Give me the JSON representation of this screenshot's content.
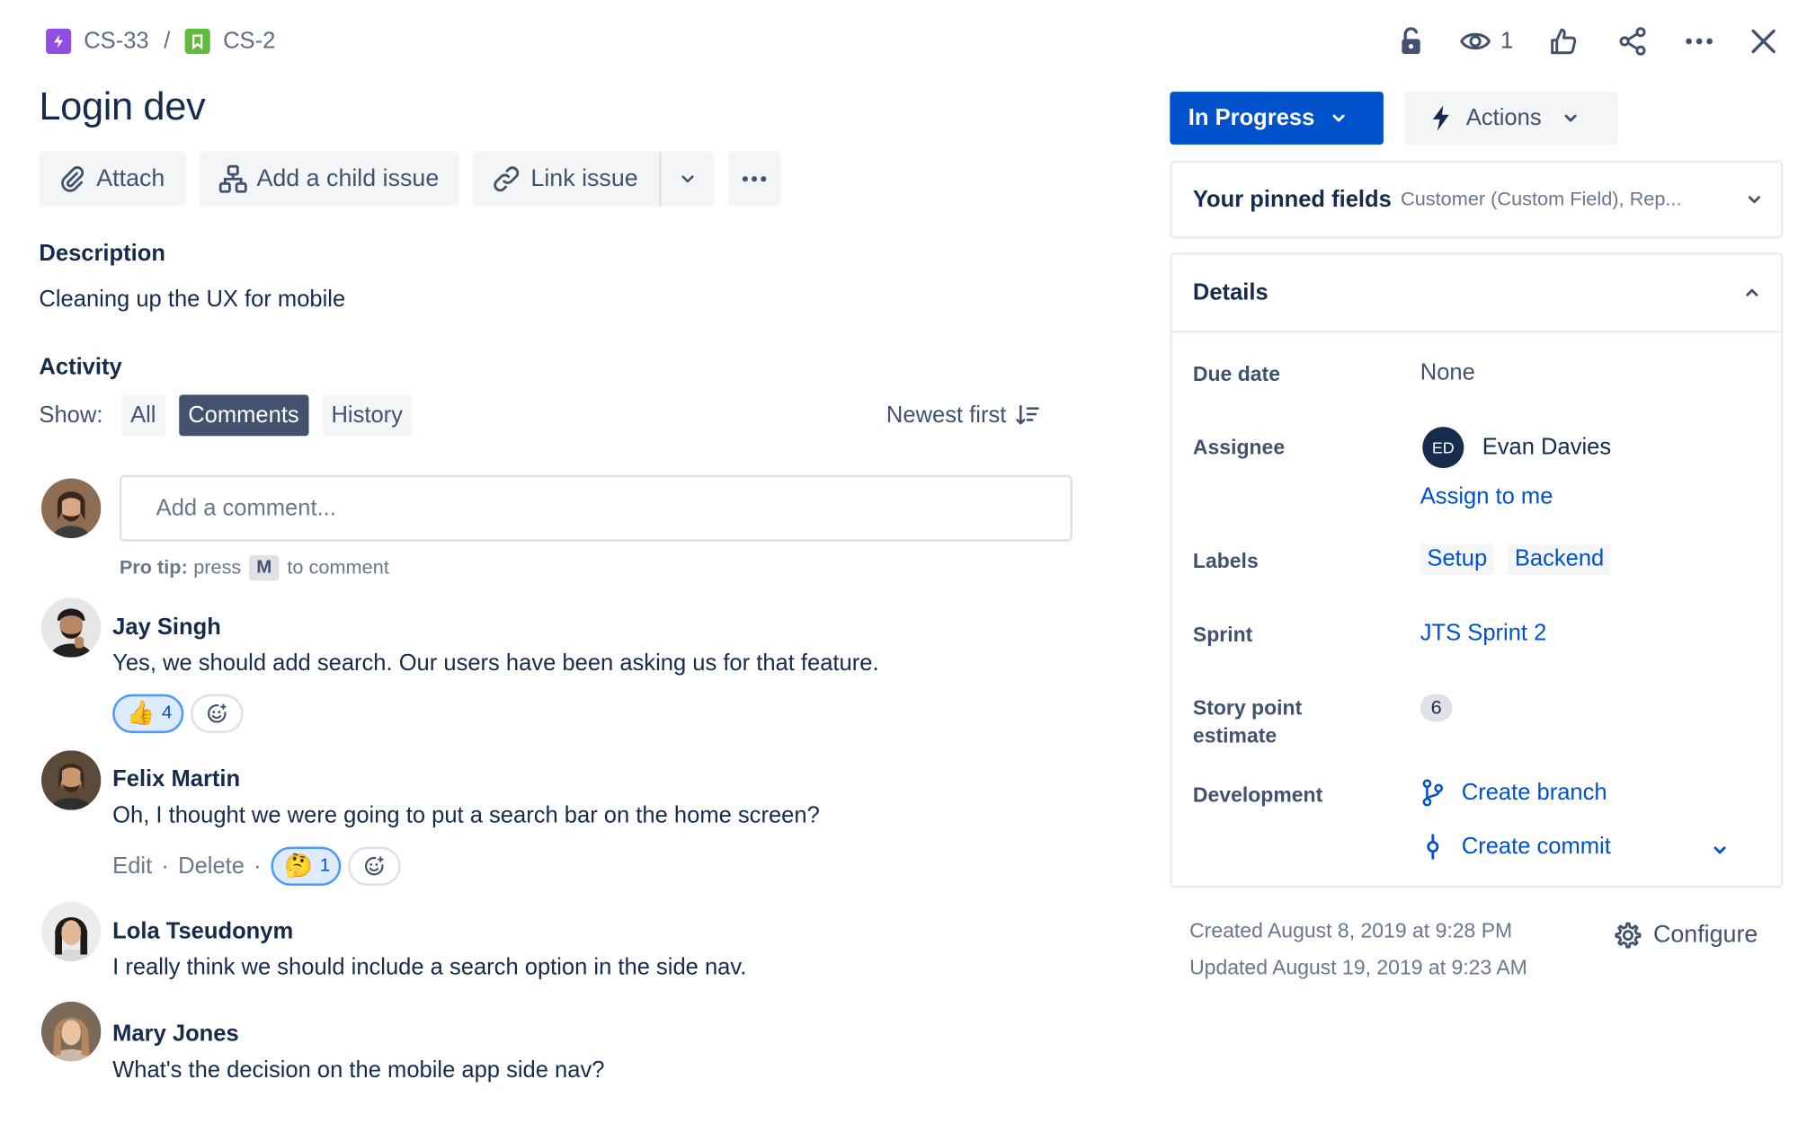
{
  "breadcrumb": {
    "parent_key": "CS-33",
    "separator": "/",
    "issue_key": "CS-2",
    "parent_icon": "epic-lightning-icon",
    "issue_icon": "story-bookmark-icon",
    "parent_color": "#904ee2",
    "issue_color": "#63ba3c"
  },
  "header_actions": {
    "watch_count": "1",
    "icons": [
      "unlock-icon",
      "eye-icon",
      "thumbs-up-icon",
      "share-icon",
      "more-icon",
      "close-icon"
    ]
  },
  "issue": {
    "title": "Login dev"
  },
  "toolbar": {
    "attach": "Attach",
    "add_child": "Add a child issue",
    "link_issue": "Link issue"
  },
  "description": {
    "heading": "Description",
    "text": "Cleaning up the UX for mobile"
  },
  "activity": {
    "heading": "Activity",
    "show_label": "Show:",
    "filters": [
      "All",
      "Comments",
      "History"
    ],
    "active_filter": "Comments",
    "sort_label": "Newest first",
    "comment_placeholder": "Add a comment...",
    "pro_tip_label": "Pro tip:",
    "pro_tip_press": "press",
    "pro_tip_key": "M",
    "pro_tip_suffix": "to comment"
  },
  "comments": [
    {
      "author": "Jay Singh",
      "body": "Yes, we should add search. Our users have been asking us for that feature.",
      "reaction_emoji": "👍",
      "reaction_count": "4"
    },
    {
      "author": "Felix Martin",
      "body": "Oh, I thought we were going to put a search bar on the home screen?",
      "edit": "Edit",
      "delete": "Delete",
      "sep": "·",
      "reaction_emoji": "🤔",
      "reaction_count": "1"
    },
    {
      "author": "Lola Tseudonym",
      "body": "I really think we should include a search option in the side nav."
    },
    {
      "author": "Mary Jones",
      "body": "What's the decision on the mobile app side nav?"
    }
  ],
  "status": {
    "label": "In Progress",
    "color": "#0052cc"
  },
  "actions": {
    "label": "Actions"
  },
  "pinned": {
    "title": "Your pinned fields",
    "value": "Customer (Custom Field), Rep..."
  },
  "details": {
    "heading": "Details",
    "due_date_label": "Due date",
    "due_date_value": "None",
    "assignee_label": "Assignee",
    "assignee_initials": "ED",
    "assignee_name": "Evan Davies",
    "assign_to_me": "Assign to me",
    "labels_label": "Labels",
    "labels": [
      "Setup",
      "Backend"
    ],
    "sprint_label": "Sprint",
    "sprint_value": "JTS Sprint 2",
    "story_point_label_1": "Story point",
    "story_point_label_2": "estimate",
    "story_point_value": "6",
    "development_label": "Development",
    "create_branch": "Create branch",
    "create_commit": "Create commit"
  },
  "meta": {
    "created": "Created August 8, 2019 at 9:28 PM",
    "updated": "Updated August 19, 2019 at 9:23 AM",
    "configure": "Configure"
  }
}
